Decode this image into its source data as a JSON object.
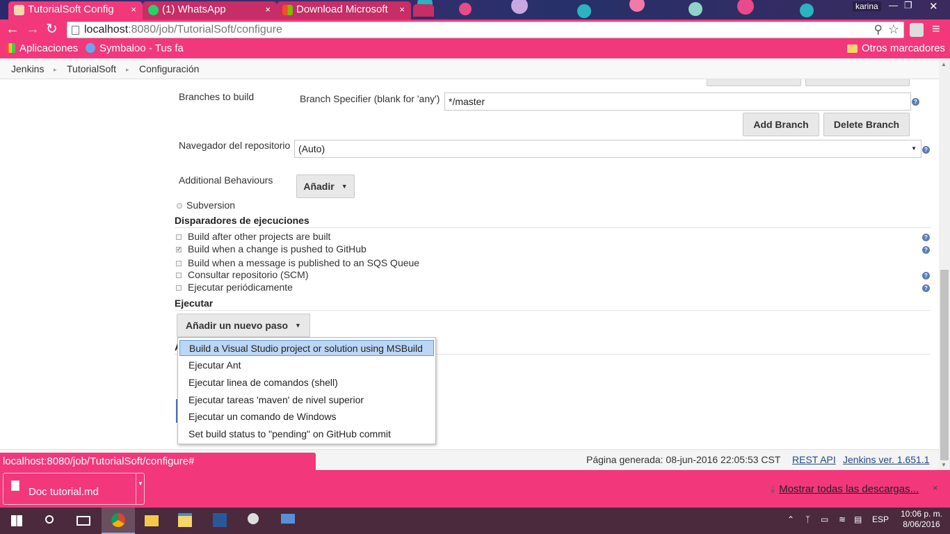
{
  "browser": {
    "tabs": [
      {
        "title": "TutorialSoft Config",
        "icon": "jenkins-butler-icon",
        "active": true
      },
      {
        "title": "(1) WhatsApp",
        "icon": "whatsapp-icon",
        "active": false
      },
      {
        "title": "Download Microsoft",
        "icon": "microsoft-icon",
        "active": false
      }
    ],
    "tab_close_glyph": "×",
    "user_name": "karina",
    "url_host": "localhost",
    "url_path": ":8080/job/TutorialSoft/configure",
    "bookmarks": [
      {
        "label": "Aplicaciones",
        "icon": "apps-grid-icon"
      },
      {
        "label": "Symbaloo - Tus fa",
        "icon": "symbaloo-icon"
      }
    ],
    "other_bookmarks": "Otros marcadores",
    "accent_color": "#f2387a"
  },
  "breadcrumb": {
    "items": [
      "Jenkins",
      "TutorialSoft",
      "Configuración"
    ],
    "separator": "▸"
  },
  "scm": {
    "branches_label": "Branches to build",
    "branch_specifier_label": "Branch Specifier (blank for 'any')",
    "branch_specifier_value": "*/master",
    "add_branch": "Add Branch",
    "delete_branch": "Delete Branch",
    "repo_browser_label": "Navegador del repositorio",
    "repo_browser_value": "(Auto)",
    "additional_behaviours_label": "Additional Behaviours",
    "anadir_button": "Añadir",
    "subversion_label": "Subversion"
  },
  "triggers": {
    "title": "Disparadores de ejecuciones",
    "items": [
      {
        "label": "Build after other projects are built",
        "checked": false,
        "help": true
      },
      {
        "label": "Build when a change is pushed to GitHub",
        "checked": true,
        "help": true
      },
      {
        "label": "Build when a message is published to an SQS Queue",
        "checked": false,
        "help": false
      },
      {
        "label": "Consultar repositorio (SCM)",
        "checked": false,
        "help": true
      },
      {
        "label": "Ejecutar periódicamente",
        "checked": false,
        "help": true
      }
    ]
  },
  "build": {
    "title": "Ejecutar",
    "add_step_button": "Añadir un nuevo paso",
    "hidden_heading_fragment": "A",
    "dropdown_items": [
      {
        "label": "Build a Visual Studio project or solution using MSBuild",
        "selected": true
      },
      {
        "label": "Ejecutar Ant",
        "selected": false
      },
      {
        "label": "Ejecutar linea de comandos (shell)",
        "selected": false
      },
      {
        "label": "Ejecutar tareas 'maven' de nivel superior",
        "selected": false
      },
      {
        "label": "Ejecutar un comando de Windows",
        "selected": false
      },
      {
        "label": "Set build status to \"pending\" on GitHub commit",
        "selected": false
      }
    ]
  },
  "footer": {
    "generated": "Página generada: 08-jun-2016 22:05:53 CST",
    "rest_api": "REST API",
    "version": "Jenkins ver. 1.651.1"
  },
  "status_url": "localhost:8080/job/TutorialSoft/configure#",
  "downloads": {
    "file": "Doc tutorial.md",
    "show_all": "Mostrar todas las descargas...",
    "close_glyph": "×"
  },
  "taskbar": {
    "apps": [
      "start-icon",
      "search-icon",
      "task-view-icon",
      "chrome-icon",
      "folder-icon",
      "file-explorer-icon",
      "word-icon",
      "snipping-icon",
      "network-icon"
    ],
    "language": "ESP",
    "time": "10:06 p. m.",
    "date": "8/06/2016"
  }
}
